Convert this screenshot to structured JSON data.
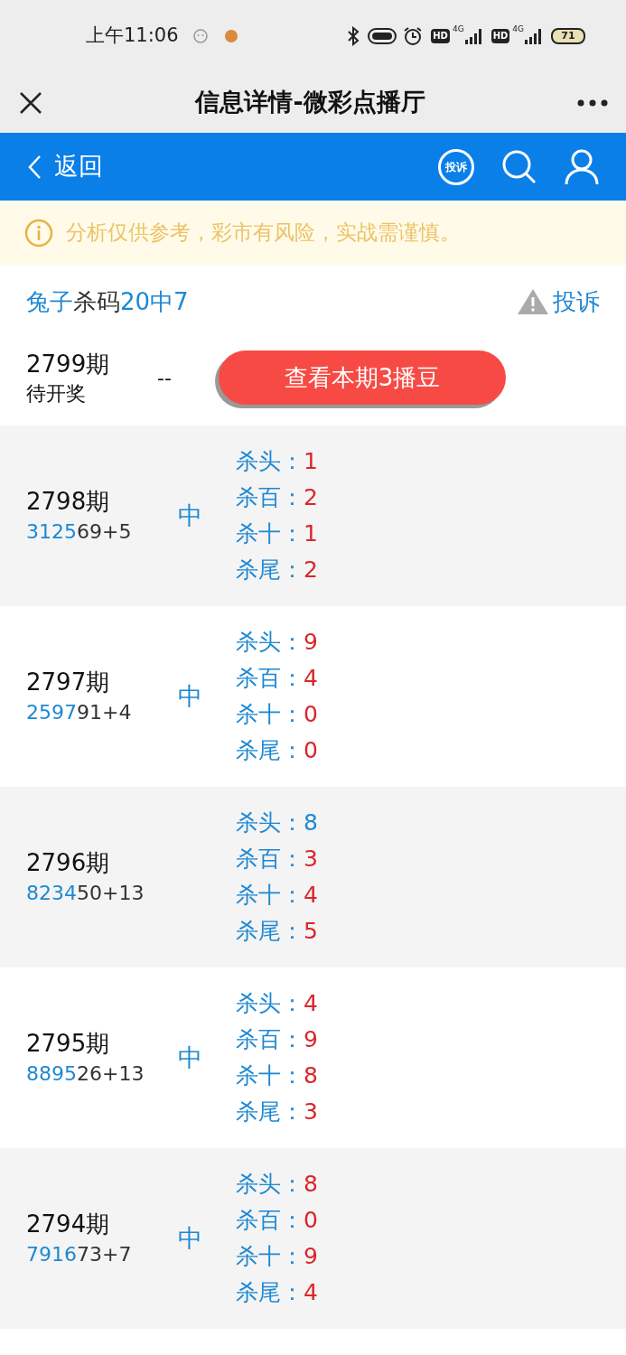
{
  "status_bar": {
    "time": "上午11:06",
    "network_1": "4G",
    "network_2": "4G",
    "hd_1": "HD",
    "hd_2": "HD",
    "battery": "71"
  },
  "title_bar": {
    "title": "信息详情-微彩点播厅"
  },
  "nav_bar": {
    "back": "返回",
    "report_badge": "投诉"
  },
  "notice": "分析仅供参考，彩市有风险，实战需谨慎。",
  "expert": {
    "name": "兔子",
    "middle": "杀码",
    "record": "20中7",
    "report": "投诉"
  },
  "current": {
    "period": "2799期",
    "status": "待开奖",
    "result": "--",
    "button": "查看本期3播豆"
  },
  "rows": [
    {
      "period": "2798期",
      "draw_highlight": "3125",
      "draw_rest": "69+5",
      "result": "中",
      "kills": [
        {
          "label": "杀头：",
          "value": "1",
          "hit": true
        },
        {
          "label": "杀百：",
          "value": "2",
          "hit": true
        },
        {
          "label": "杀十：",
          "value": "1",
          "hit": true
        },
        {
          "label": "杀尾：",
          "value": "2",
          "hit": true
        }
      ]
    },
    {
      "period": "2797期",
      "draw_highlight": "2597",
      "draw_rest": "91+4",
      "result": "中",
      "kills": [
        {
          "label": "杀头：",
          "value": "9",
          "hit": true
        },
        {
          "label": "杀百：",
          "value": "4",
          "hit": true
        },
        {
          "label": "杀十：",
          "value": "0",
          "hit": true
        },
        {
          "label": "杀尾：",
          "value": "0",
          "hit": true
        }
      ]
    },
    {
      "period": "2796期",
      "draw_highlight": "8234",
      "draw_rest": "50+13",
      "kills": [
        {
          "label": "杀头：",
          "value": "8",
          "hit": false
        },
        {
          "label": "杀百：",
          "value": "3",
          "hit": true
        },
        {
          "label": "杀十：",
          "value": "4",
          "hit": true
        },
        {
          "label": "杀尾：",
          "value": "5",
          "hit": true
        }
      ]
    },
    {
      "period": "2795期",
      "draw_highlight": "8895",
      "draw_rest": "26+13",
      "result": "中",
      "kills": [
        {
          "label": "杀头：",
          "value": "4",
          "hit": true
        },
        {
          "label": "杀百：",
          "value": "9",
          "hit": true
        },
        {
          "label": "杀十：",
          "value": "8",
          "hit": true
        },
        {
          "label": "杀尾：",
          "value": "3",
          "hit": true
        }
      ]
    },
    {
      "period": "2794期",
      "draw_highlight": "7916",
      "draw_rest": "73+7",
      "result": "中",
      "kills": [
        {
          "label": "杀头：",
          "value": "8",
          "hit": true
        },
        {
          "label": "杀百：",
          "value": "0",
          "hit": true
        },
        {
          "label": "杀十：",
          "value": "9",
          "hit": true
        },
        {
          "label": "杀尾：",
          "value": "4",
          "hit": true
        }
      ]
    }
  ]
}
